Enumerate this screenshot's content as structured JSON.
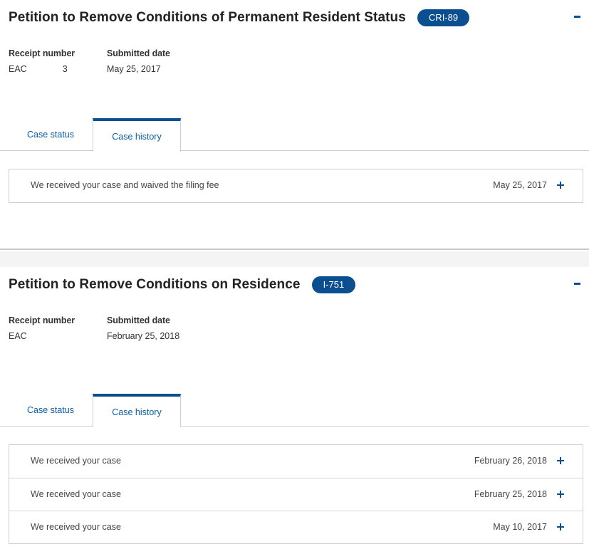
{
  "cases": [
    {
      "title": "Petition to Remove Conditions of Permanent Resident Status",
      "form_badge": "CRI-89",
      "receipt_label": "Receipt number",
      "receipt_value": "EAC",
      "receipt_tail": "3",
      "submitted_label": "Submitted date",
      "submitted_value": "May 25, 2017",
      "tabs": {
        "status": "Case status",
        "history": "Case history"
      },
      "active_tab": "Case history",
      "history": [
        {
          "text": "We received your case and waived the filing fee",
          "date": "May 25, 2017"
        }
      ]
    },
    {
      "title": "Petition to Remove Conditions on Residence",
      "form_badge": "I-751",
      "receipt_label": "Receipt number",
      "receipt_value": "EAC",
      "receipt_tail": "",
      "submitted_label": "Submitted date",
      "submitted_value": "February 25, 2018",
      "tabs": {
        "status": "Case status",
        "history": "Case history"
      },
      "active_tab": "Case history",
      "history": [
        {
          "text": "We received your case",
          "date": "February 26, 2018"
        },
        {
          "text": "We received your case",
          "date": "February 25, 2018"
        },
        {
          "text": "We received your case",
          "date": "May 10, 2017"
        }
      ]
    }
  ],
  "colors": {
    "accent": "#0b4f91",
    "link": "#0b5ea6",
    "border": "#cfcfcf"
  },
  "icons": {
    "collapse": "minus-icon",
    "expand": "plus-icon"
  }
}
